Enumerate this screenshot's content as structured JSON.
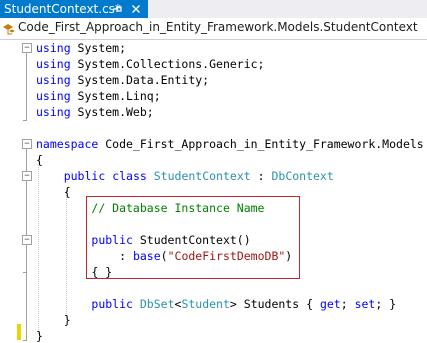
{
  "tab": {
    "title": "StudentContext.cs*",
    "active_color": "#007acc",
    "pin_icon": "pin-icon",
    "close_icon": "close-icon"
  },
  "navbar": {
    "icon": "class-icon",
    "text": "Code_First_Approach_in_Entity_Framework.Models.StudentContext"
  },
  "colors": {
    "keyword": "#0000ff",
    "type": "#2b91af",
    "string": "#a31515",
    "comment": "#008000",
    "highlight_border": "#c0282d",
    "change_bar": "#eed100"
  },
  "code": {
    "l1": {
      "kw": "using",
      "rest": " System;"
    },
    "l2": {
      "kw": "using",
      "rest": " System.Collections.Generic;"
    },
    "l3": {
      "kw": "using",
      "rest": " System.Data.Entity;"
    },
    "l4": {
      "kw": "using",
      "rest": " System.Linq;"
    },
    "l5": {
      "kw": "using",
      "rest": " System.Web;"
    },
    "l7": {
      "kw": "namespace",
      "rest": " Code_First_Approach_in_Entity_Framework.Models"
    },
    "l8": {
      "text": "{"
    },
    "l9": {
      "kw1": "public",
      "kw2": "class",
      "type1": "StudentContext",
      "sep": " : ",
      "type2": "DbContext"
    },
    "l10": {
      "text": "{"
    },
    "l11": {
      "comment": "// Database Instance Name"
    },
    "l13": {
      "kw": "public",
      "rest": " StudentContext()"
    },
    "l14": {
      "pre": ": ",
      "kw": "base",
      "open": "(",
      "str": "\"CodeFirstDemoDB\"",
      "close": ")"
    },
    "l15": {
      "text": "{ }"
    },
    "l17": {
      "kw": "public",
      "type1": "DbSet",
      "lt": "<",
      "type2": "Student",
      "gt": ">",
      "rest": " Students { ",
      "kw_get": "get",
      "mid": "; ",
      "kw_set": "set",
      "end": "; }"
    },
    "l18": {
      "text": "}"
    },
    "l19": {
      "text": "}"
    }
  }
}
